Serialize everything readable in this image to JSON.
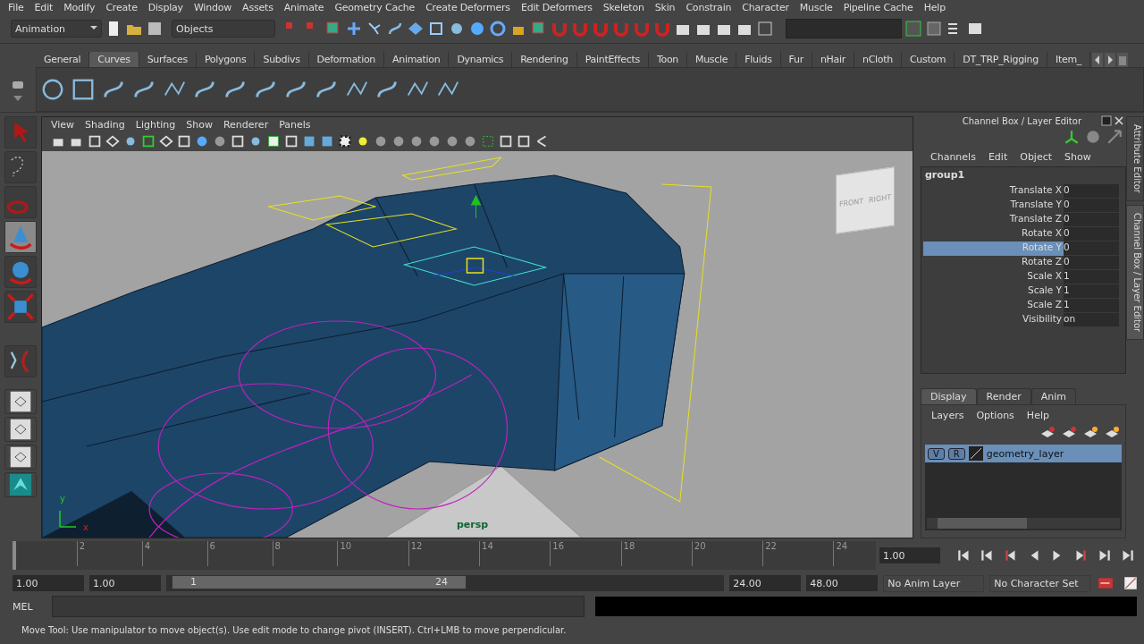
{
  "menu_bar": [
    "File",
    "Edit",
    "Modify",
    "Create",
    "Display",
    "Window",
    "Assets",
    "Animate",
    "Geometry Cache",
    "Create Deformers",
    "Edit Deformers",
    "Skeleton",
    "Skin",
    "Constrain",
    "Character",
    "Muscle",
    "Pipeline Cache",
    "Help"
  ],
  "status_line": {
    "menu_set": "Animation",
    "selection_mode": "Objects"
  },
  "shelf_tabs": [
    {
      "label": "General",
      "selected": false
    },
    {
      "label": "Curves",
      "selected": true
    },
    {
      "label": "Surfaces",
      "selected": false
    },
    {
      "label": "Polygons",
      "selected": false
    },
    {
      "label": "Subdivs",
      "selected": false
    },
    {
      "label": "Deformation",
      "selected": false
    },
    {
      "label": "Animation",
      "selected": false
    },
    {
      "label": "Dynamics",
      "selected": false
    },
    {
      "label": "Rendering",
      "selected": false
    },
    {
      "label": "PaintEffects",
      "selected": false
    },
    {
      "label": "Toon",
      "selected": false
    },
    {
      "label": "Muscle",
      "selected": false
    },
    {
      "label": "Fluids",
      "selected": false
    },
    {
      "label": "Fur",
      "selected": false
    },
    {
      "label": "nHair",
      "selected": false
    },
    {
      "label": "nCloth",
      "selected": false
    },
    {
      "label": "Custom",
      "selected": false
    },
    {
      "label": "DT_TRP_Rigging",
      "selected": false
    },
    {
      "label": "Item_",
      "selected": false
    }
  ],
  "toolbox": [
    {
      "selected": false
    },
    {
      "selected": false
    },
    {
      "selected": false
    },
    {
      "selected": true
    },
    {
      "selected": false
    },
    {
      "selected": false
    }
  ],
  "viewport": {
    "menu": [
      "View",
      "Shading",
      "Lighting",
      "Show",
      "Renderer",
      "Panels"
    ],
    "camera": "persp",
    "view_cube": {
      "front": "FRONT",
      "right": "RIGHT"
    },
    "axis": {
      "x": "x",
      "y": "y"
    }
  },
  "channel_box": {
    "title": "Channel Box / Layer Editor",
    "menu": [
      "Channels",
      "Edit",
      "Object",
      "Show"
    ],
    "object": "group1",
    "channels": [
      {
        "name": "Translate X",
        "value": "0",
        "selected": false
      },
      {
        "name": "Translate Y",
        "value": "0",
        "selected": false
      },
      {
        "name": "Translate Z",
        "value": "0",
        "selected": false
      },
      {
        "name": "Rotate X",
        "value": "0",
        "selected": false
      },
      {
        "name": "Rotate Y",
        "value": "0",
        "selected": true
      },
      {
        "name": "Rotate Z",
        "value": "0",
        "selected": false
      },
      {
        "name": "Scale X",
        "value": "1",
        "selected": false
      },
      {
        "name": "Scale Y",
        "value": "1",
        "selected": false
      },
      {
        "name": "Scale Z",
        "value": "1",
        "selected": false
      },
      {
        "name": "Visibility",
        "value": "on",
        "selected": false
      }
    ]
  },
  "layer_editor": {
    "tabs": [
      {
        "label": "Display",
        "selected": true
      },
      {
        "label": "Render",
        "selected": false
      },
      {
        "label": "Anim",
        "selected": false
      }
    ],
    "menu": [
      "Layers",
      "Options",
      "Help"
    ],
    "layers": [
      {
        "visible": "V",
        "render": "R",
        "name": "geometry_layer",
        "selected": true
      }
    ]
  },
  "side_tabs": [
    {
      "label": "Attribute Editor",
      "selected": false
    },
    {
      "label": "Channel Box / Layer Editor",
      "selected": true
    }
  ],
  "time_slider": {
    "ticks": [
      "2",
      "4",
      "6",
      "8",
      "10",
      "12",
      "14",
      "16",
      "18",
      "20",
      "22",
      "24"
    ],
    "current_time": "1.00",
    "level": 0
  },
  "range_slider": {
    "animation_start": "1.00",
    "playback_start": "1.00",
    "range_start": "1",
    "range_end": "24",
    "playback_end": "24.00",
    "animation_end": "48.00",
    "anim_layer": "No Anim Layer",
    "character_set": "No Character Set"
  },
  "command_line": {
    "label": "MEL"
  },
  "help_line": "Move Tool: Use manipulator to move object(s). Use edit mode to change pivot (INSERT).  Ctrl+LMB to move perpendicular."
}
